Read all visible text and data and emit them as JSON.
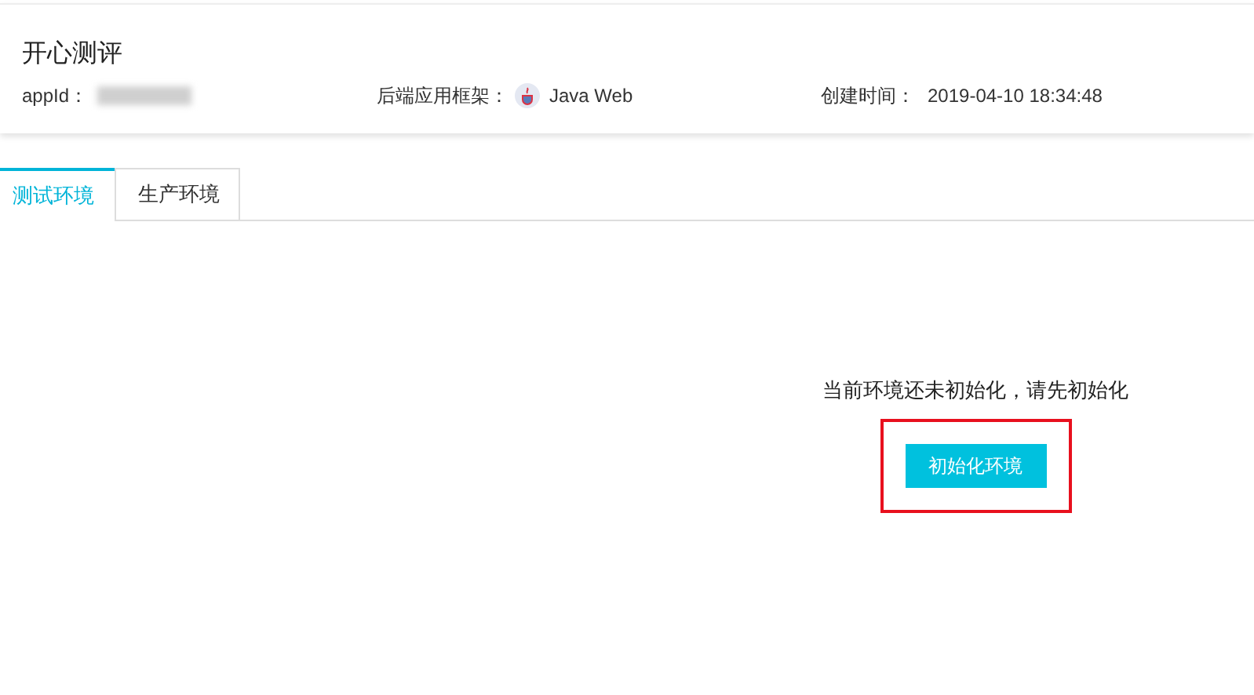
{
  "header": {
    "title": "开心测评",
    "app_id_label": "appId：",
    "framework_label": "后端应用框架：",
    "framework": "Java Web",
    "created_label": "创建时间：",
    "created": "2019-04-10 18:34:48"
  },
  "tabs": [
    {
      "label": "测试环境",
      "selected": true
    },
    {
      "label": "生产环境",
      "selected": false
    }
  ],
  "empty_state": {
    "message": "当前环境还未初始化，请先初始化",
    "button": "初始化环境",
    "highlighted": true
  }
}
